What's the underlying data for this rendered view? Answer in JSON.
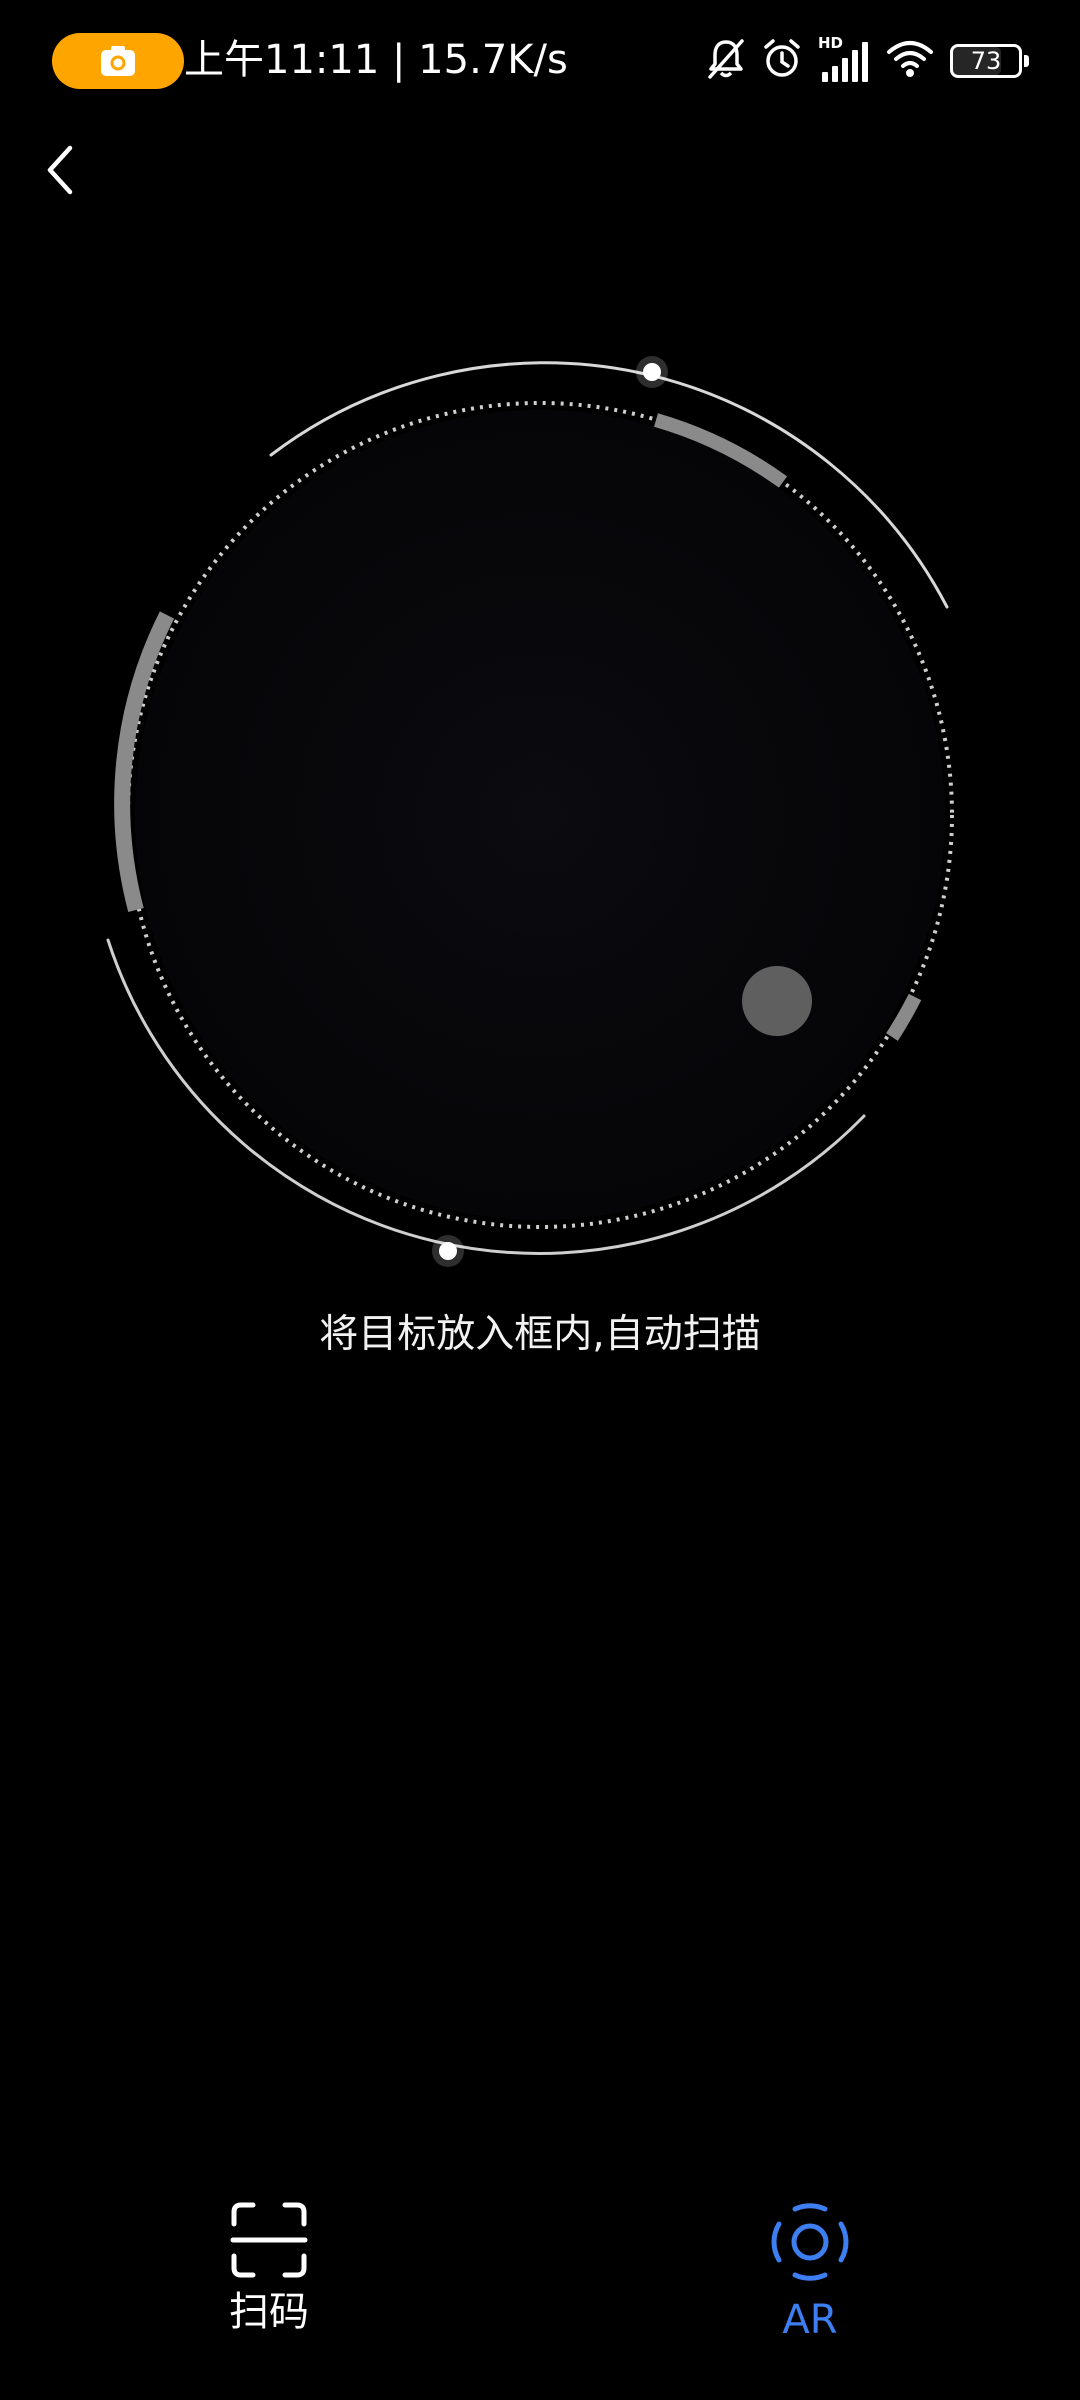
{
  "status_bar": {
    "time_and_speed": "上午11:11 | 15.7K/s",
    "signal_label": "HD",
    "battery_level": "73",
    "icons": [
      "camera-icon",
      "bell-muted-icon",
      "alarm-icon",
      "signal-icon",
      "wifi-icon",
      "battery-icon"
    ]
  },
  "nav": {
    "back_icon": "chevron-left-icon"
  },
  "scanner": {
    "hint": "将目标放入框内,自动扫描"
  },
  "tabs": [
    {
      "label": "扫码",
      "icon": "scan-frame-icon",
      "active": false
    },
    {
      "label": "AR",
      "icon": "ar-target-icon",
      "active": true
    }
  ],
  "colors": {
    "background": "#000000",
    "camera_pill": "#FFA500",
    "active_tab": "#3d7ff0",
    "inactive_tab": "#ffffff"
  }
}
